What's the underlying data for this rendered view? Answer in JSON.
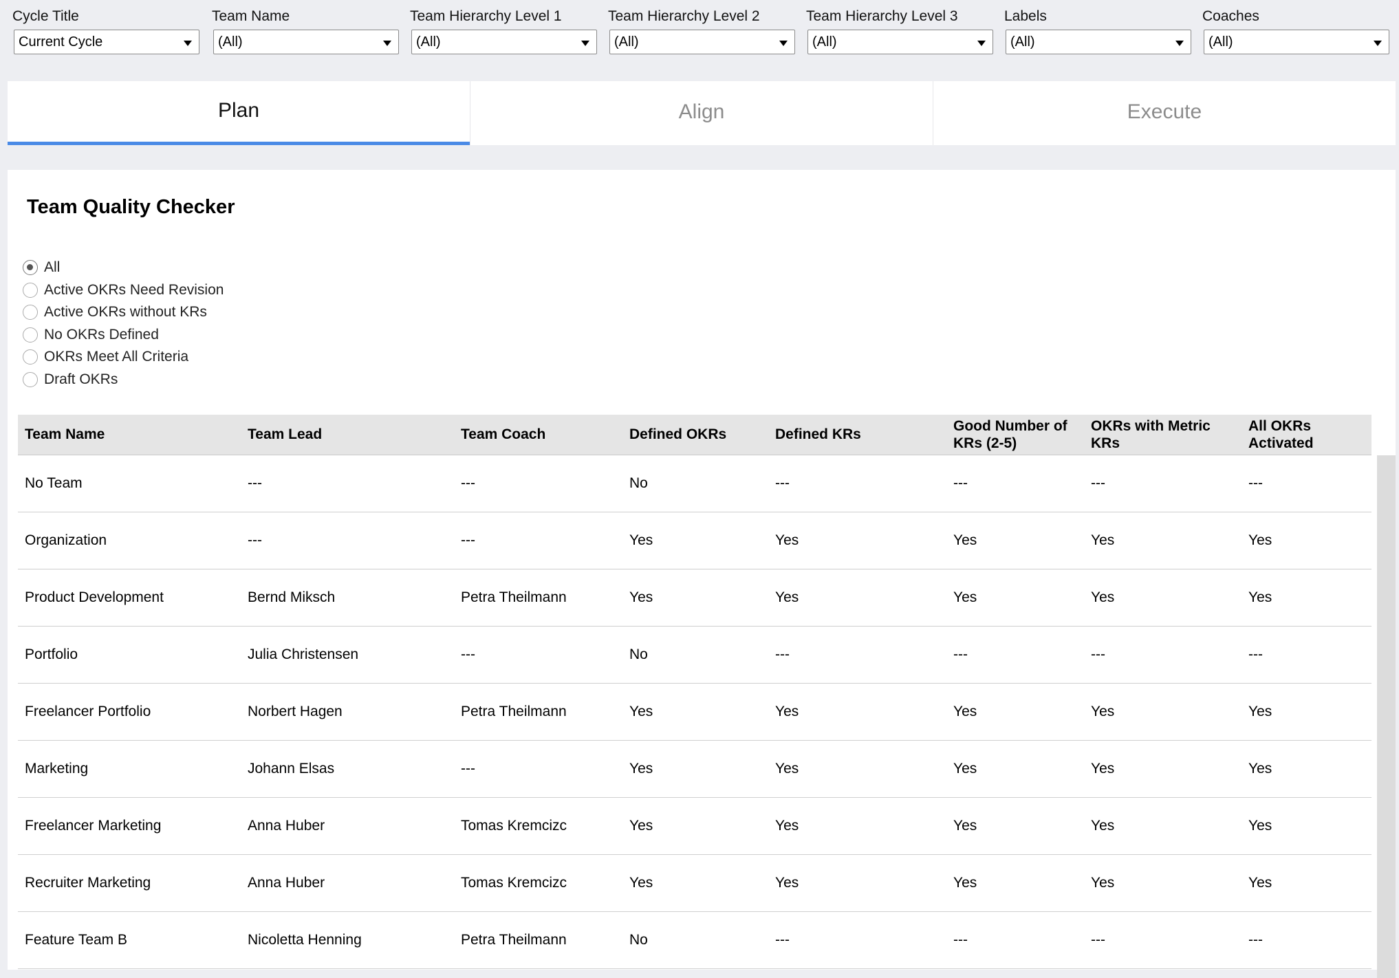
{
  "filters": [
    {
      "label": "Cycle Title",
      "value": "Current Cycle"
    },
    {
      "label": "Team Name",
      "value": "(All)"
    },
    {
      "label": "Team Hierarchy Level 1",
      "value": "(All)"
    },
    {
      "label": "Team Hierarchy Level 2",
      "value": "(All)"
    },
    {
      "label": "Team Hierarchy Level 3",
      "value": "(All)"
    },
    {
      "label": "Labels",
      "value": "(All)"
    },
    {
      "label": "Coaches",
      "value": "(All)"
    }
  ],
  "tabs": [
    {
      "label": "Plan",
      "active": true
    },
    {
      "label": "Align",
      "active": false
    },
    {
      "label": "Execute",
      "active": false
    }
  ],
  "panel": {
    "title": "Team Quality Checker",
    "radio_options": [
      {
        "label": "All",
        "checked": true
      },
      {
        "label": "Active OKRs Need Revision",
        "checked": false
      },
      {
        "label": "Active OKRs without KRs",
        "checked": false
      },
      {
        "label": "No OKRs Defined",
        "checked": false
      },
      {
        "label": "OKRs Meet All Criteria",
        "checked": false
      },
      {
        "label": "Draft OKRs",
        "checked": false
      }
    ]
  },
  "table": {
    "columns": [
      "Team Name",
      "Team Lead",
      "Team Coach",
      "Defined OKRs",
      "Defined KRs",
      "Good Number of KRs (2-5)",
      "OKRs with Metric KRs",
      "All OKRs Activated"
    ],
    "rows": [
      [
        "No Team",
        "---",
        "---",
        "No",
        "---",
        "---",
        "---",
        "---"
      ],
      [
        "Organization",
        "---",
        "---",
        "Yes",
        "Yes",
        "Yes",
        "Yes",
        "Yes"
      ],
      [
        "Product Development",
        "Bernd Miksch",
        "Petra Theilmann",
        "Yes",
        "Yes",
        "Yes",
        "Yes",
        "Yes"
      ],
      [
        "Portfolio",
        "Julia Christensen",
        "---",
        "No",
        "---",
        "---",
        "---",
        "---"
      ],
      [
        "Freelancer Portfolio",
        "Norbert Hagen",
        "Petra Theilmann",
        "Yes",
        "Yes",
        "Yes",
        "Yes",
        "Yes"
      ],
      [
        "Marketing",
        "Johann Elsas",
        "---",
        "Yes",
        "Yes",
        "Yes",
        "Yes",
        "Yes"
      ],
      [
        "Freelancer Marketing",
        "Anna Huber",
        "Tomas Kremcizc",
        "Yes",
        "Yes",
        "Yes",
        "Yes",
        "Yes"
      ],
      [
        "Recruiter Marketing",
        "Anna Huber",
        "Tomas Kremcizc",
        "Yes",
        "Yes",
        "Yes",
        "Yes",
        "Yes"
      ],
      [
        "Feature Team B",
        "Nicoletta Henning",
        "Petra Theilmann",
        "No",
        "---",
        "---",
        "---",
        "---"
      ]
    ]
  }
}
